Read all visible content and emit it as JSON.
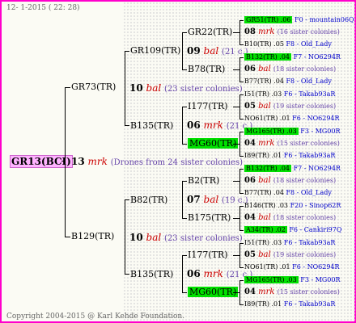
{
  "header_date": "12-  1-2015 ( 22: 28)",
  "footer": "Copyright 2004-2015 @ Karl Kehde Foundation.",
  "root": {
    "label": "GR13(BCI)",
    "num": "13",
    "mark": "mrk",
    "note": "(Drones from 24 sister colonies)"
  },
  "g1": [
    {
      "label": "GR73(TR)",
      "num": "10",
      "mark": "bal",
      "note": "(23 sister colonies)"
    },
    {
      "label": "B129(TR)",
      "num": "10",
      "mark": "bal",
      "note": "(23 sister colonies)"
    }
  ],
  "g2": [
    {
      "label": "GR109(TR)",
      "num": "09",
      "mark": "bal",
      "note": "(21 c.)"
    },
    {
      "label": "B135(TR)",
      "num": "06",
      "mark": "mrk",
      "note": "(21 c.)"
    },
    {
      "label": "B82(TR)",
      "num": "07",
      "mark": "bal",
      "note": "(19 c.)"
    },
    {
      "label": "B135(TR)",
      "num": "06",
      "mark": "mrk",
      "note": "(21 c.)"
    }
  ],
  "g3": [
    {
      "label": "GR22(TR)"
    },
    {
      "label": "B78(TR)"
    },
    {
      "label": "I177(TR)"
    },
    {
      "label": "MG60(TR)"
    },
    {
      "label": "B2(TR)"
    },
    {
      "label": "B175(TR)"
    },
    {
      "label": "I177(TR)"
    },
    {
      "label": "MG60(TR)"
    }
  ],
  "g4": [
    {
      "top": "GR51(TR) .06",
      "topr": "F0 - mountain06Q",
      "num": "08",
      "mark": "mrk",
      "note": "(16 sister colonies)",
      "bot": "B10(TR) .05",
      "botr": "F8 - Old_Lady"
    },
    {
      "top": "B132(TR) .04",
      "topr": "F7 - NO6294R",
      "num": "06",
      "mark": "bal",
      "note": "(18 sister colonies)",
      "bot": "B77(TR) .04",
      "botr": "F8 - Old_Lady"
    },
    {
      "top": "I51(TR) .03",
      "topr": "F6 - Takab93aR",
      "num": "05",
      "mark": "bal",
      "note": "(19 sister colonies)",
      "bot": "NO61(TR) .01",
      "botr": "F6 - NO6294R"
    },
    {
      "top": "MG165(TR) .03",
      "topr": "F3 - MG00R",
      "num": "04",
      "mark": "mrk",
      "note": "(15 sister colonies)",
      "bot": "I89(TR) .01",
      "botr": "F6 - Takab93aR"
    },
    {
      "top": "B132(TR) .04",
      "topr": "F7 - NO6294R",
      "num": "06",
      "mark": "bal",
      "note": "(18 sister colonies)",
      "bot": "B77(TR) .04",
      "botr": "F8 - Old_Lady"
    },
    {
      "top": "B146(TR) .03",
      "topr": "F20 - Sinop62R",
      "num": "04",
      "mark": "bal",
      "note": "(18 sister colonies)",
      "bot": "A34(TR) .02",
      "botr": "F6 - Cankiri97Q"
    },
    {
      "top": "I51(TR) .03",
      "topr": "F6 - Takab93aR",
      "num": "05",
      "mark": "bal",
      "note": "(19 sister colonies)",
      "bot": "NO61(TR) .01",
      "botr": "F6 - NO6294R"
    },
    {
      "top": "MG165(TR) .03",
      "topr": "F3 - MG00R",
      "num": "04",
      "mark": "mrk",
      "note": "(15 sister colonies)",
      "bot": "I89(TR) .01",
      "botr": "F6 - Takab93aR"
    }
  ]
}
